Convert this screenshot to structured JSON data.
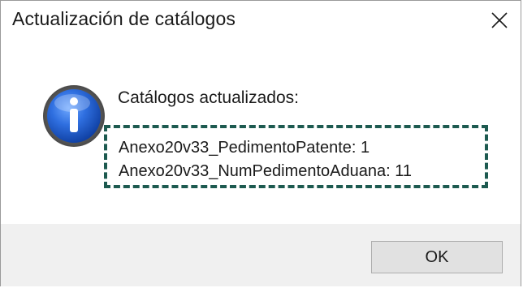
{
  "dialog": {
    "title": "Actualización de catálogos",
    "close_icon": "close-icon"
  },
  "message": {
    "icon": "information-icon",
    "heading": "Catálogos actualizados:",
    "items": [
      "Anexo20v33_PedimentoPatente: 1",
      "Anexo20v33_NumPedimentoAduana: 11"
    ],
    "highlight_color": "#1d5a50"
  },
  "footer": {
    "ok_label": "OK"
  }
}
